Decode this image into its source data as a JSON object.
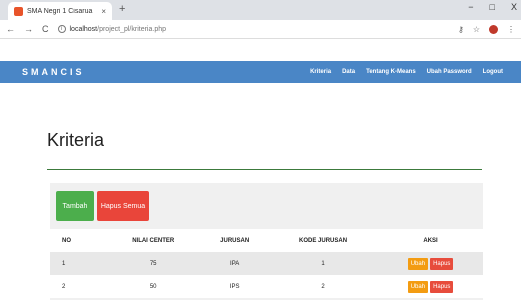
{
  "browser": {
    "tab_title": "SMA Negri 1 Cisarua",
    "tab_close": "×",
    "new_tab": "+",
    "url_host": "localhost",
    "url_path": "/project_pl/kriteria.php",
    "win_minimize": "−",
    "win_maximize": "□",
    "win_close": "X"
  },
  "navbar": {
    "brand": "SMANCIS",
    "menu": [
      "Kriteria",
      "Data",
      "Tentang K-Means",
      "Ubah Password",
      "Logout"
    ]
  },
  "page": {
    "title": "Kriteria",
    "add_button": "Tambah",
    "delete_all_button": "Hapus Semua"
  },
  "table": {
    "headers": [
      "NO",
      "NILAI CENTER",
      "JURUSAN",
      "KODE JURUSAN",
      "AKSI"
    ],
    "rows": [
      {
        "no": "1",
        "nilai_center": "75",
        "jurusan": "IPA",
        "kode": "1"
      },
      {
        "no": "2",
        "nilai_center": "50",
        "jurusan": "IPS",
        "kode": "2"
      }
    ],
    "edit_label": "Ubah",
    "delete_label": "Hapus"
  },
  "colors": {
    "navbar": "#4a86c6",
    "add": "#4cae4c",
    "delete_all": "#e9453a",
    "edit": "#f39c12",
    "delete": "#e74c3c"
  }
}
